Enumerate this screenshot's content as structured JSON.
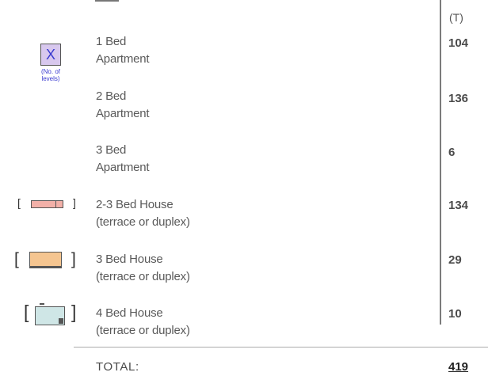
{
  "header": {
    "unit": "(T)"
  },
  "legend": {
    "x_symbol": "X",
    "levels_note": "(No. of levels)"
  },
  "rows": [
    {
      "line1": "1 Bed",
      "line2": "Apartment",
      "value": "104"
    },
    {
      "line1": "2 Bed",
      "line2": "Apartment",
      "value": "136"
    },
    {
      "line1": "3 Bed",
      "line2": "Apartment",
      "value": "6"
    },
    {
      "line1": "2-3 Bed House",
      "line2": "(terrace or duplex)",
      "value": "134"
    },
    {
      "line1": "3 Bed House",
      "line2": "(terrace or duplex)",
      "value": "29"
    },
    {
      "line1": "4 Bed House",
      "line2": "(terrace or duplex)",
      "value": "10"
    }
  ],
  "total": {
    "label": "TOTAL:",
    "value": "419"
  },
  "colors": {
    "house_small": "#f2b0a8",
    "house_medium": "#f5c590",
    "house_large": "#cfe6e6",
    "apartment_symbol": "#d8c8ee"
  }
}
